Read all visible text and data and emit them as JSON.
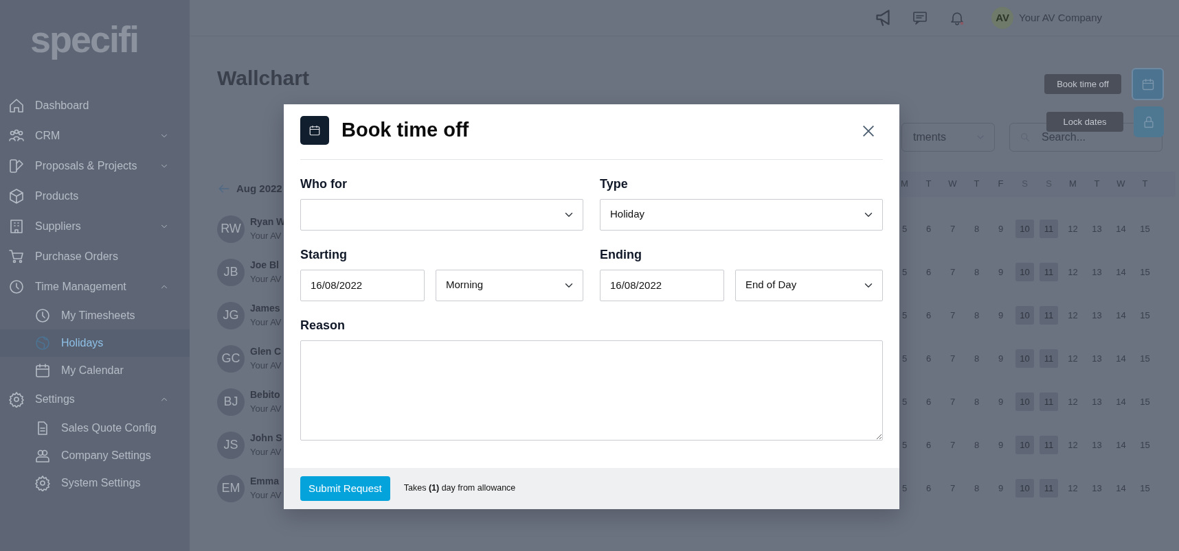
{
  "sidebar": {
    "logo": "specifi",
    "items": [
      {
        "label": "Dashboard",
        "kind": "link",
        "selected": false
      },
      {
        "label": "CRM",
        "kind": "group",
        "expanded": false,
        "selected": false
      },
      {
        "label": "Proposals & Projects",
        "kind": "group",
        "expanded": false,
        "selected": false
      },
      {
        "label": "Products",
        "kind": "link",
        "selected": false
      },
      {
        "label": "Suppliers",
        "kind": "group",
        "expanded": false,
        "selected": false
      },
      {
        "label": "Purchase Orders",
        "kind": "link",
        "selected": false
      },
      {
        "label": "Time Management",
        "kind": "group",
        "expanded": true,
        "selected": false,
        "children": [
          {
            "label": "My Timesheets",
            "selected": false
          },
          {
            "label": "Holidays",
            "selected": true
          },
          {
            "label": "My Calendar",
            "selected": false
          }
        ]
      },
      {
        "label": "Settings",
        "kind": "group",
        "expanded": true,
        "selected": false,
        "children": [
          {
            "label": "Sales Quote Config",
            "selected": false
          },
          {
            "label": "Company Settings",
            "selected": false
          },
          {
            "label": "System Settings",
            "selected": false
          }
        ]
      }
    ]
  },
  "topbar": {
    "notifications_unread": true,
    "avatar_initials": "AV",
    "company": "Your AV Company"
  },
  "page": {
    "title": "Wallchart",
    "department_filter": "tments",
    "search": {
      "placeholder": "Search..."
    },
    "actions": [
      {
        "label": "Book time off",
        "kind": "calendar"
      },
      {
        "label": "Lock dates",
        "kind": "lock"
      }
    ]
  },
  "wallchart": {
    "month": "Aug 2022",
    "day_headers": [
      {
        "label": "M",
        "weekend": false
      },
      {
        "label": "T",
        "weekend": false
      },
      {
        "label": "W",
        "weekend": false
      },
      {
        "label": "T",
        "weekend": false
      },
      {
        "label": "F",
        "weekend": false
      },
      {
        "label": "S",
        "weekend": true
      },
      {
        "label": "S",
        "weekend": true
      },
      {
        "label": "M",
        "weekend": false
      },
      {
        "label": "T",
        "weekend": false
      },
      {
        "label": "W",
        "weekend": false
      },
      {
        "label": "T",
        "weekend": false
      }
    ],
    "people": [
      {
        "initials": "RW",
        "name": "Ryan W",
        "company": "Your AV",
        "days": [
          "5",
          "6",
          "7",
          "8",
          "9",
          "10",
          "11",
          "12",
          "13",
          "14",
          "15"
        ]
      },
      {
        "initials": "JB",
        "name": "Joe Bl",
        "company": "Your AV",
        "days": [
          "5",
          "6",
          "7",
          "8",
          "9",
          "10",
          "11",
          "12",
          "13",
          "14",
          "15"
        ]
      },
      {
        "initials": "JG",
        "name": "James",
        "company": "Your AV",
        "days": [
          "5",
          "6",
          "7",
          "8",
          "9",
          "10",
          "11",
          "12",
          "13",
          "14",
          "15"
        ]
      },
      {
        "initials": "GC",
        "name": "Glen C",
        "company": "Your AV",
        "days": [
          "5",
          "6",
          "7",
          "8",
          "9",
          "10",
          "11",
          "12",
          "13",
          "14",
          "15"
        ]
      },
      {
        "initials": "BJ",
        "name": "Bebito",
        "company": "Your AV",
        "days": [
          "5",
          "6",
          "7",
          "8",
          "9",
          "10",
          "11",
          "12",
          "13",
          "14",
          "15"
        ]
      },
      {
        "initials": "JS",
        "name": "John S",
        "company": "Your AV",
        "days": [
          "5",
          "6",
          "7",
          "8",
          "9",
          "10",
          "11",
          "12",
          "13",
          "14",
          "15"
        ]
      },
      {
        "initials": "EM",
        "name": "Emma",
        "company": "Your AV",
        "days": [
          "5",
          "6",
          "7",
          "8",
          "9",
          "10",
          "11",
          "12",
          "13",
          "14",
          "15"
        ]
      }
    ]
  },
  "modal": {
    "title": "Book time off",
    "who_for": {
      "label": "Who for"
    },
    "type": {
      "label": "Type",
      "value": "Holiday"
    },
    "starting": {
      "label": "Starting",
      "date": "16/08/2022",
      "session": "Morning"
    },
    "ending": {
      "label": "Ending",
      "date": "16/08/2022",
      "session": "End of Day"
    },
    "reason": {
      "label": "Reason"
    },
    "submit": "Submit Request",
    "allowance_note": "Takes **(1)** day from allowance"
  }
}
